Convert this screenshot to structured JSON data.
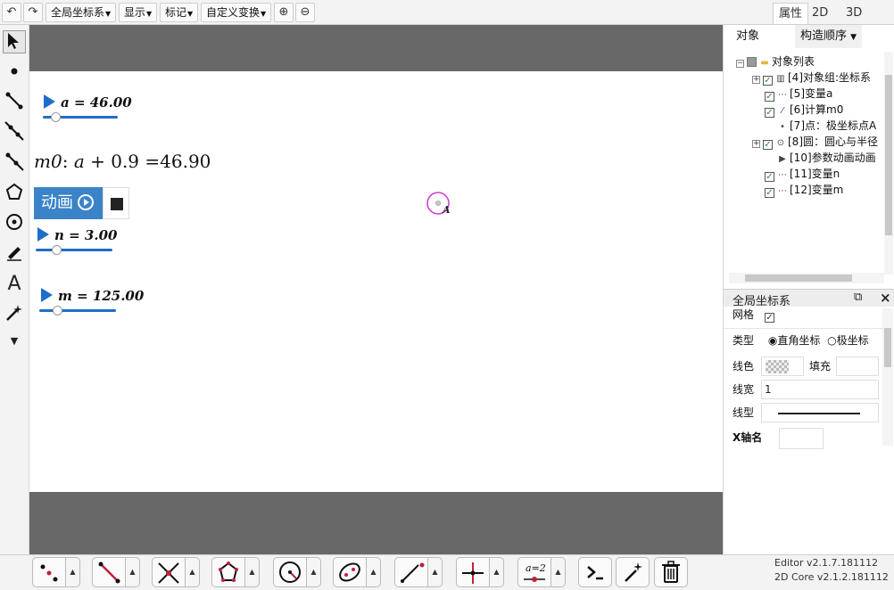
{
  "toolbar": {
    "undo_icon": "undo-arrow-icon",
    "redo_icon": "redo-arrow-icon",
    "global_coords": "全局坐标系",
    "display": "显示",
    "mark": "标记",
    "custom_transform": "自定义变换",
    "zoom_in_icon": "magnifier-plus-icon",
    "zoom_out_icon": "magnifier-minus-icon"
  },
  "view_tabs": [
    "属性",
    "2D",
    "3D"
  ],
  "canvas": {
    "sliders": [
      {
        "var": "a",
        "text": "a = 46.00",
        "value": 46.0
      },
      {
        "var": "n",
        "text": "n = 3.00",
        "value": 3.0
      },
      {
        "var": "m",
        "text": "m = 125.00",
        "value": 125.0
      }
    ],
    "formula": {
      "name": "m0",
      "sep": ":",
      "var": "a",
      "op": "+ 0.9",
      "result": "=46.90"
    },
    "anim_button": "动画",
    "point_label": "A",
    "colors": {
      "band": "#686868",
      "slider": "#1e6ec8",
      "anim": "#3a83c8",
      "circle": "#d040d0"
    }
  },
  "panel": {
    "tab_objects": "对象",
    "tab_order": "构造顺序",
    "tree_root": "对象列表",
    "tree_items": [
      "[4]对象组:坐标系",
      "[5]变量a",
      "[6]计算m0",
      "[7]点：极坐标点A",
      "[8]圆：圆心与半径",
      "[10]参数动画动画",
      "[11]变量n",
      "[12]变量m"
    ],
    "props_title": "全局坐标系",
    "props": {
      "grid": "网格",
      "type": "类型",
      "type_cartesian": "直角坐标",
      "type_polar": "极坐标",
      "line_color": "线色",
      "fill": "填充",
      "line_width": "线宽",
      "line_width_value": "1",
      "line_type": "线型",
      "x_axis_name": "X轴名"
    }
  },
  "versions": {
    "editor": "Editor v2.1.7.181112",
    "core": "2D Core v2.1.2.181112"
  }
}
